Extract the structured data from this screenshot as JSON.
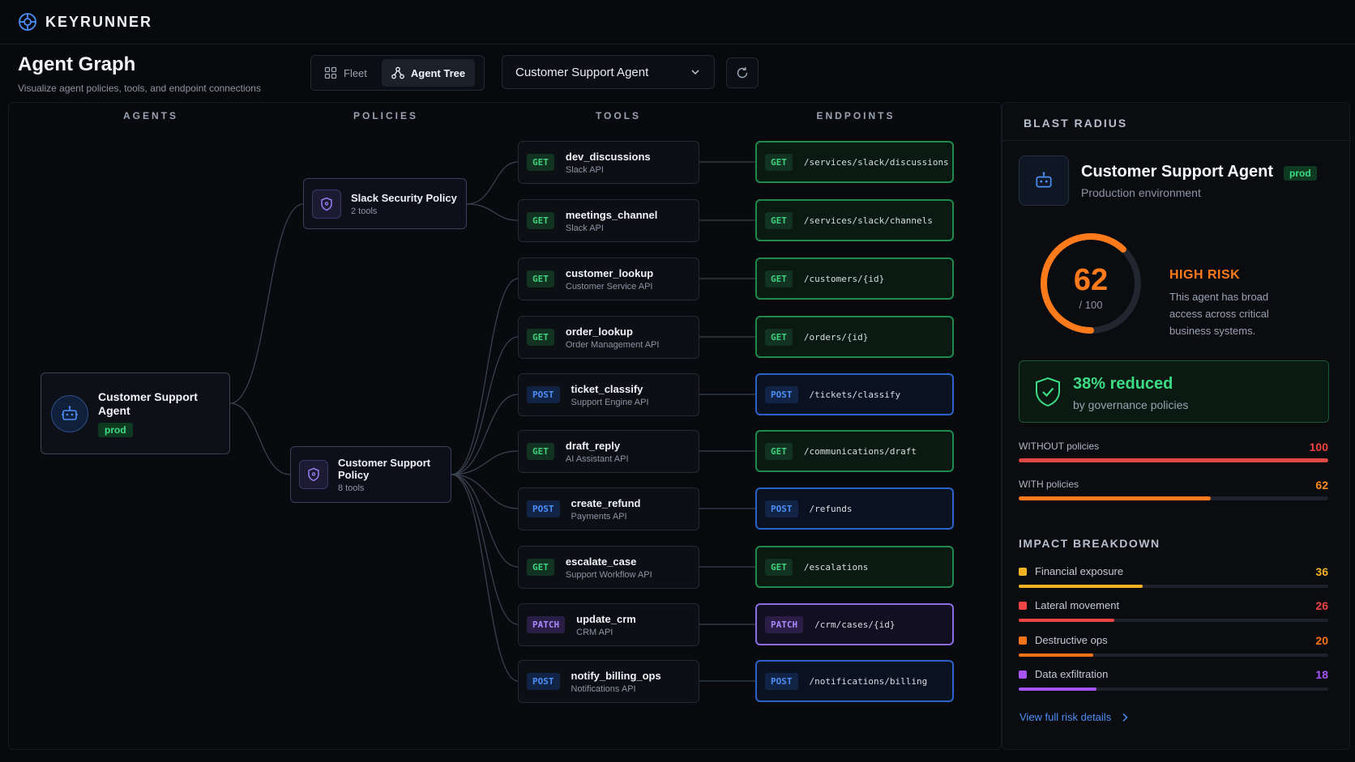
{
  "brand": {
    "name": "KEYRUNNER"
  },
  "header": {
    "title": "Agent Graph",
    "subtitle": "Visualize agent policies, tools, and endpoint connections"
  },
  "view_toggle": {
    "fleet_label": "Fleet",
    "tree_label": "Agent Tree",
    "active": "Agent Tree"
  },
  "agent_select": {
    "value": "Customer Support Agent"
  },
  "columns": {
    "agents": "AGENTS",
    "policies": "POLICIES",
    "tools": "TOOLS",
    "endpoints": "ENDPOINTS"
  },
  "agent": {
    "name": "Customer Support Agent",
    "tag": "prod"
  },
  "policies": [
    {
      "name": "Slack Security Policy",
      "count": "2 tools"
    },
    {
      "name": "Customer Support Policy",
      "count": "8 tools"
    }
  ],
  "tools": [
    {
      "method": "GET",
      "name": "dev_discussions",
      "api": "Slack API"
    },
    {
      "method": "GET",
      "name": "meetings_channel",
      "api": "Slack API"
    },
    {
      "method": "GET",
      "name": "customer_lookup",
      "api": "Customer Service API"
    },
    {
      "method": "GET",
      "name": "order_lookup",
      "api": "Order Management API"
    },
    {
      "method": "POST",
      "name": "ticket_classify",
      "api": "Support Engine API"
    },
    {
      "method": "GET",
      "name": "draft_reply",
      "api": "AI Assistant API"
    },
    {
      "method": "POST",
      "name": "create_refund",
      "api": "Payments API"
    },
    {
      "method": "GET",
      "name": "escalate_case",
      "api": "Support Workflow API"
    },
    {
      "method": "PATCH",
      "name": "update_crm",
      "api": "CRM API"
    },
    {
      "method": "POST",
      "name": "notify_billing_ops",
      "api": "Notifications API"
    }
  ],
  "endpoints": [
    {
      "method": "GET",
      "path": "/services/slack/discussions"
    },
    {
      "method": "GET",
      "path": "/services/slack/channels"
    },
    {
      "method": "GET",
      "path": "/customers/{id}"
    },
    {
      "method": "GET",
      "path": "/orders/{id}"
    },
    {
      "method": "POST",
      "path": "/tickets/classify"
    },
    {
      "method": "GET",
      "path": "/communications/draft"
    },
    {
      "method": "POST",
      "path": "/refunds"
    },
    {
      "method": "GET",
      "path": "/escalations"
    },
    {
      "method": "PATCH",
      "path": "/crm/cases/{id}"
    },
    {
      "method": "POST",
      "path": "/notifications/billing"
    }
  ],
  "blast_radius": {
    "title": "BLAST RADIUS",
    "agent_name": "Customer Support Agent",
    "tag": "prod",
    "environment": "Production environment",
    "score": "62",
    "score_max": "/ 100",
    "score_fraction": 0.62,
    "risk_label": "HIGH RISK",
    "risk_desc": "This agent has broad access across critical business systems.",
    "reduced_main": "38% reduced",
    "reduced_sub": "by governance policies",
    "without": {
      "label": "WITHOUT policies",
      "value": "100",
      "fraction": 1.0
    },
    "with": {
      "label": "WITH policies",
      "value": "62",
      "fraction": 0.62
    },
    "impact_title": "IMPACT BREAKDOWN",
    "impacts": [
      {
        "label": "Financial exposure",
        "value": "36",
        "color": "#f5b323",
        "fraction": 0.4
      },
      {
        "label": "Lateral movement",
        "value": "26",
        "color": "#ef4444",
        "fraction": 0.31
      },
      {
        "label": "Destructive ops",
        "value": "20",
        "color": "#f97316",
        "fraction": 0.24
      },
      {
        "label": "Data exfiltration",
        "value": "18",
        "color": "#a855f7",
        "fraction": 0.25
      }
    ],
    "link_label": "View full risk details"
  },
  "colors": {
    "accent": "#4d8ef7",
    "risk": "#ff7a1a",
    "ok": "#3ddc84",
    "danger": "#ef4444"
  }
}
